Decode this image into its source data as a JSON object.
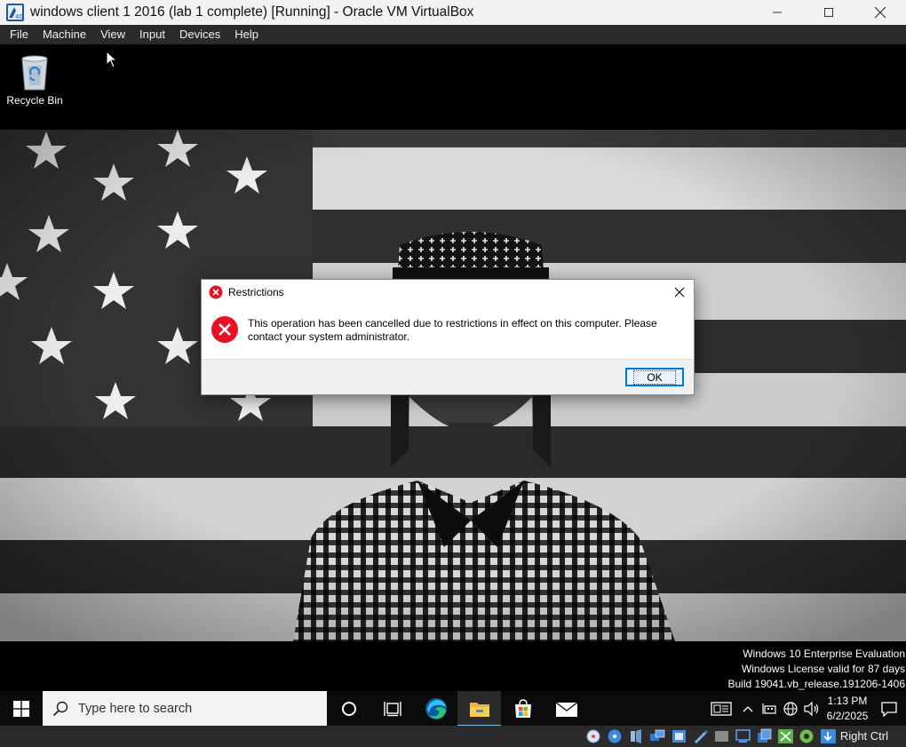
{
  "host_window": {
    "title": "windows client 1 2016 (lab 1 complete) [Running] - Oracle VM VirtualBox",
    "controls": {
      "minimize": "minimize",
      "maximize": "maximize",
      "close": "close"
    }
  },
  "vbox_menu": [
    "File",
    "Machine",
    "View",
    "Input",
    "Devices",
    "Help"
  ],
  "desktop": {
    "icons": [
      {
        "label": "Recycle Bin",
        "icon": "recycle-bin-icon"
      }
    ]
  },
  "dialog": {
    "title": "Restrictions",
    "message": "This operation has been cancelled due to restrictions in effect on this computer. Please contact your system administrator.",
    "ok_label": "OK",
    "accent": "#e81123"
  },
  "watermark": {
    "line1": "Windows 10 Enterprise Evaluation",
    "line2": "Windows License valid for 87 days",
    "line3": "Build 19041.vb_release.191206-1406"
  },
  "taskbar": {
    "search_placeholder": "Type here to search",
    "pinned": [
      "cortana-icon",
      "task-view-icon",
      "edge-icon",
      "file-explorer-icon",
      "store-icon",
      "mail-icon"
    ],
    "active": "file-explorer-icon",
    "clock_time": "1:13 PM",
    "clock_date": "6/2/2025"
  },
  "vbox_status": {
    "host_key": "Right Ctrl"
  }
}
